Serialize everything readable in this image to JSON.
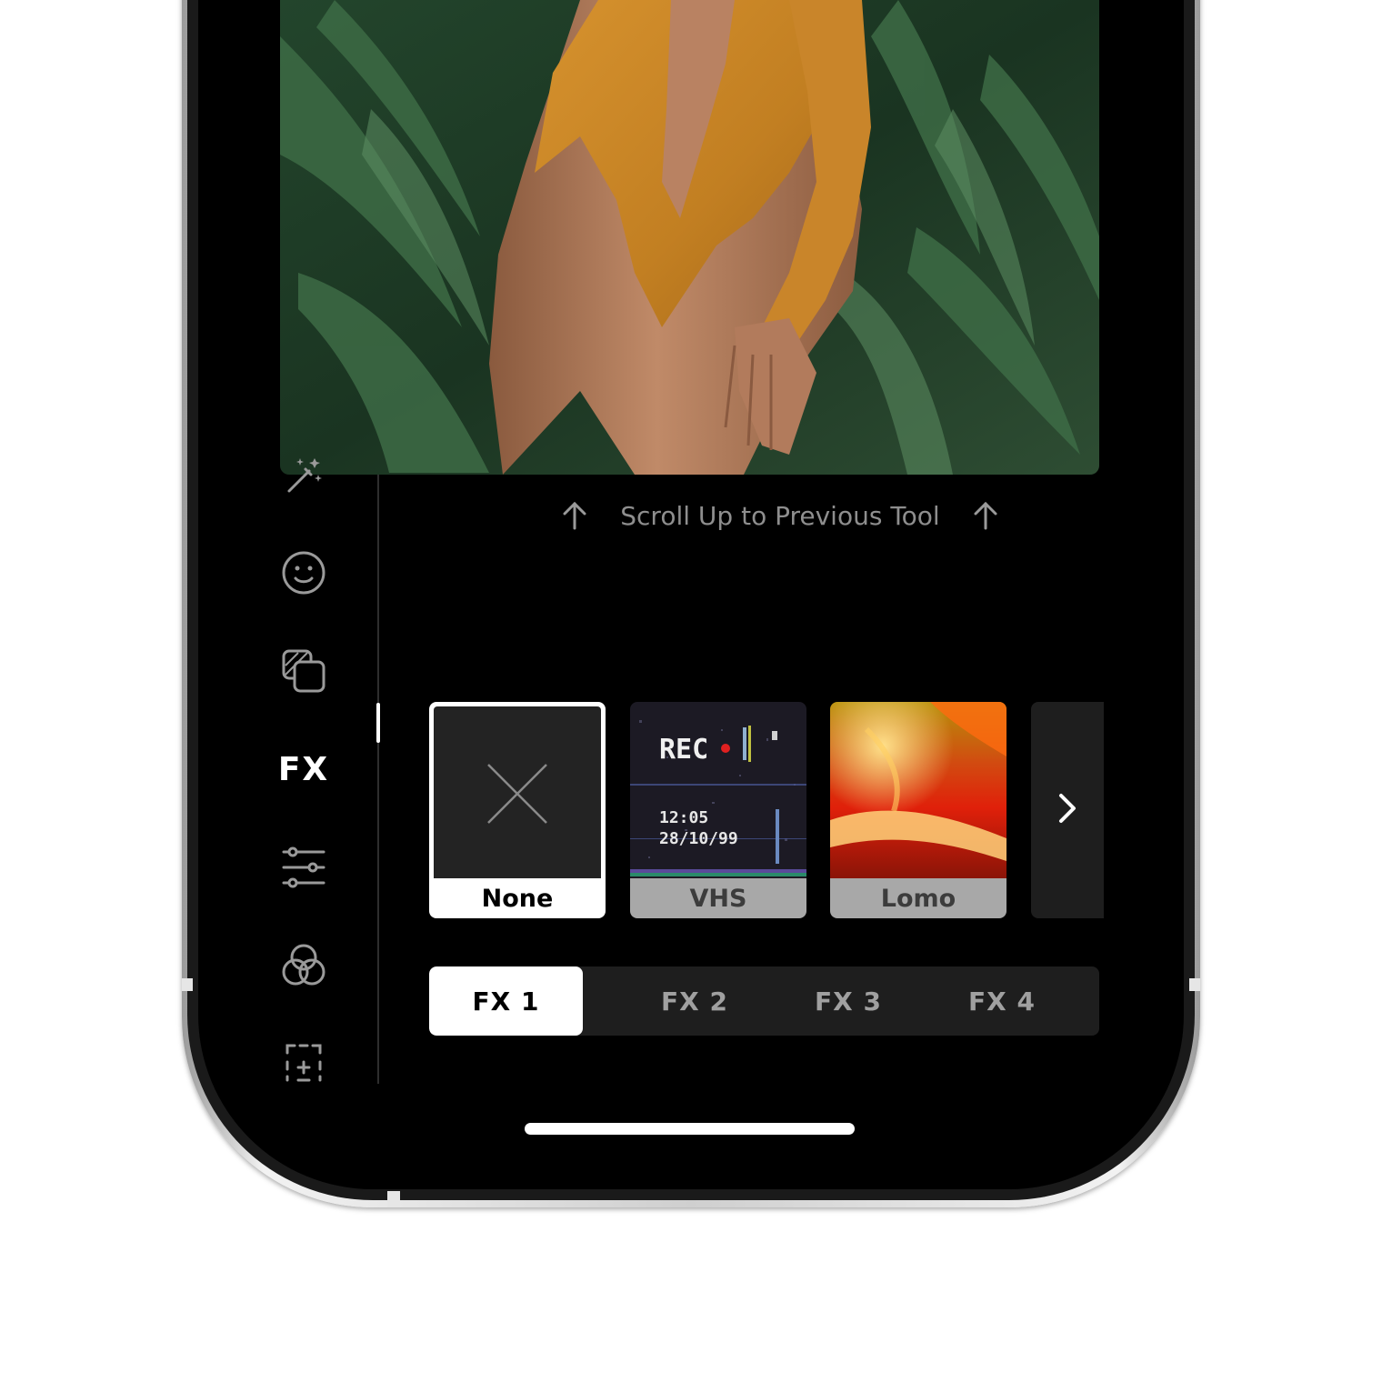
{
  "hint": {
    "scroll_up_label": "Scroll Up to Previous Tool",
    "arrow_icon": "arrow-up-icon"
  },
  "sidebar": {
    "tools": [
      {
        "name": "magic-wand-icon"
      },
      {
        "name": "face-icon"
      },
      {
        "name": "layers-icon"
      },
      {
        "name": "fx",
        "label": "FX",
        "active": true
      },
      {
        "name": "sliders-icon"
      },
      {
        "name": "color-circles-icon"
      },
      {
        "name": "crop-icon"
      }
    ]
  },
  "effects": {
    "items": [
      {
        "label": "None",
        "selected": true
      },
      {
        "label": "VHS",
        "selected": false,
        "overlay": {
          "rec": "REC",
          "time": "12:05",
          "date": "28/10/99"
        }
      },
      {
        "label": "Lomo",
        "selected": false
      }
    ],
    "more_icon": "chevron-right-icon"
  },
  "fx_slots": {
    "tabs": [
      "FX 1",
      "FX 2",
      "FX 3",
      "FX 4"
    ],
    "active_index": 0
  },
  "colors": {
    "background": "#000000",
    "selected": "#ffffff",
    "panel": "#1e1e1e",
    "muted_text": "#8e8e8e",
    "rec_dot": "#e02020"
  }
}
